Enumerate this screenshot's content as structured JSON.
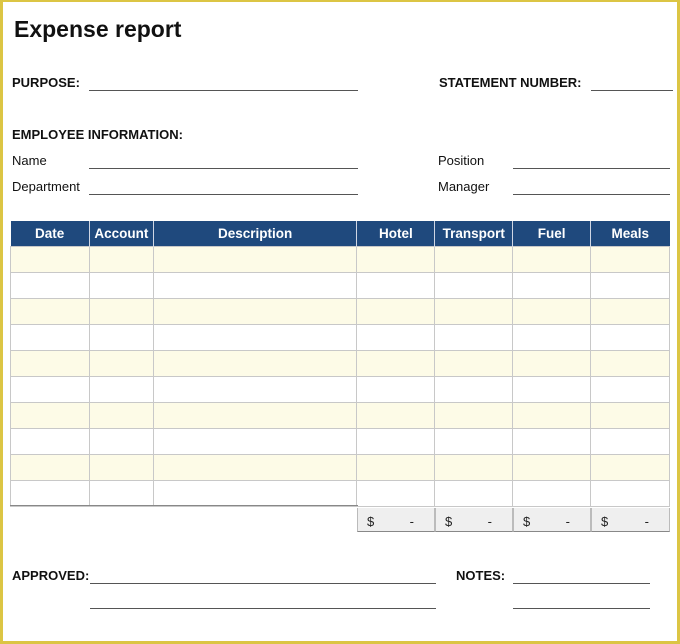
{
  "title": "Expense report",
  "purpose_label": "PURPOSE:",
  "statement_label": "STATEMENT NUMBER:",
  "employee_label": "EMPLOYEE INFORMATION:",
  "fields": {
    "name": "Name",
    "department": "Department",
    "position": "Position",
    "manager": "Manager"
  },
  "table": {
    "columns": [
      "Date",
      "Account",
      "Description",
      "Hotel",
      "Transport",
      "Fuel",
      "Meals"
    ],
    "row_count": 10
  },
  "totals": [
    {
      "currency": "$",
      "value": "-"
    },
    {
      "currency": "$",
      "value": "-"
    },
    {
      "currency": "$",
      "value": "-"
    },
    {
      "currency": "$",
      "value": "-"
    }
  ],
  "approved_label": "APPROVED:",
  "notes_label": "NOTES:",
  "colors": {
    "header": "#1f497d",
    "row_alt": "#fdfbe7",
    "border": "#dcc544"
  }
}
